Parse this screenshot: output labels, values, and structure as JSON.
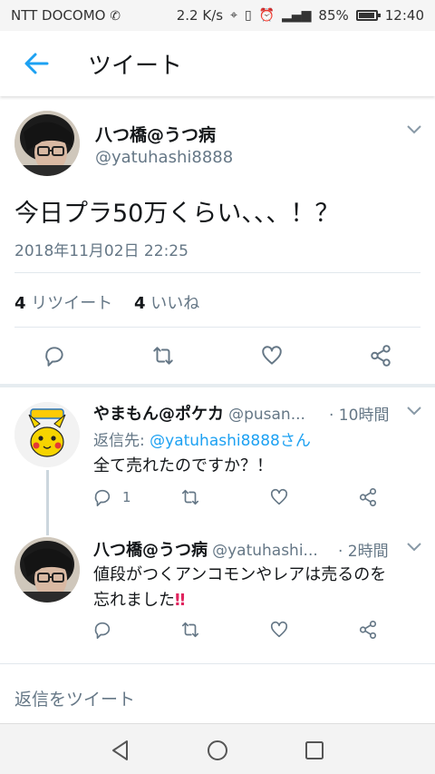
{
  "status_bar": {
    "carrier": "NTT DOCOMO",
    "speed": "2.2 K/s",
    "battery": "85%",
    "time": "12:40"
  },
  "header": {
    "title": "ツイート"
  },
  "tweet": {
    "name": "八つ橋@うつ病",
    "handle": "@yatuhashi8888",
    "text": "今日プラ50万くらい、、、！？",
    "timestamp": "2018年11月02日 22:25",
    "retweet_count": "4",
    "retweet_label": "リツイート",
    "like_count": "4",
    "like_label": "いいね"
  },
  "replies": [
    {
      "name": "やまもん@ポケカ",
      "handle": "@pusan...",
      "time": "· 10時間",
      "reply_to_prefix": "返信先: ",
      "reply_to_handle": "@yatuhashi8888",
      "reply_to_suffix": "さん",
      "text": "全て売れたのですか？！",
      "reply_count": "1"
    },
    {
      "name": "八つ橋@うつ病",
      "handle": "@yatuhashi...",
      "time": "· 2時間",
      "text_line1": "値段がつくアンコモンやレアは売るのを",
      "text_line2": "忘れました‼",
      "reply_count": ""
    }
  ],
  "reply_bar": {
    "placeholder": "返信をツイート"
  },
  "colors": {
    "twitter_blue": "#1da1f2",
    "gray_text": "#657786",
    "icon_gray": "#657786",
    "alert_red": "#e0245e"
  }
}
